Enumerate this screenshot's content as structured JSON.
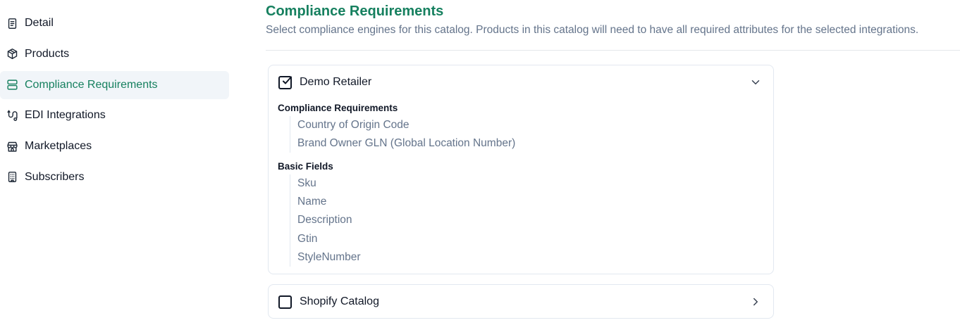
{
  "sidebar": {
    "items": [
      {
        "label": "Detail",
        "icon": "document-icon",
        "active": false
      },
      {
        "label": "Products",
        "icon": "package-icon",
        "active": false
      },
      {
        "label": "Compliance Requirements",
        "icon": "server-icon",
        "active": true
      },
      {
        "label": "EDI Integrations",
        "icon": "route-icon",
        "active": false
      },
      {
        "label": "Marketplaces",
        "icon": "store-icon",
        "active": false
      },
      {
        "label": "Subscribers",
        "icon": "building-icon",
        "active": false
      }
    ]
  },
  "main": {
    "title": "Compliance Requirements",
    "subtitle": "Select compliance engines for this catalog. Products in this catalog will need to have all required attributes for the selected integrations.",
    "integrations": [
      {
        "name": "Demo Retailer",
        "checked": true,
        "expanded": true,
        "sections": [
          {
            "heading": "Compliance Requirements",
            "fields": [
              "Country of Origin Code",
              "Brand Owner GLN (Global Location Number)"
            ]
          },
          {
            "heading": "Basic Fields",
            "fields": [
              "Sku",
              "Name",
              "Description",
              "Gtin",
              "StyleNumber"
            ]
          }
        ]
      },
      {
        "name": "Shopify Catalog",
        "checked": false,
        "expanded": false
      }
    ]
  },
  "colors": {
    "accent": "#16805f",
    "muted_text": "#64748b",
    "active_bg": "#f1f5f9",
    "border": "#e2e8f0"
  }
}
